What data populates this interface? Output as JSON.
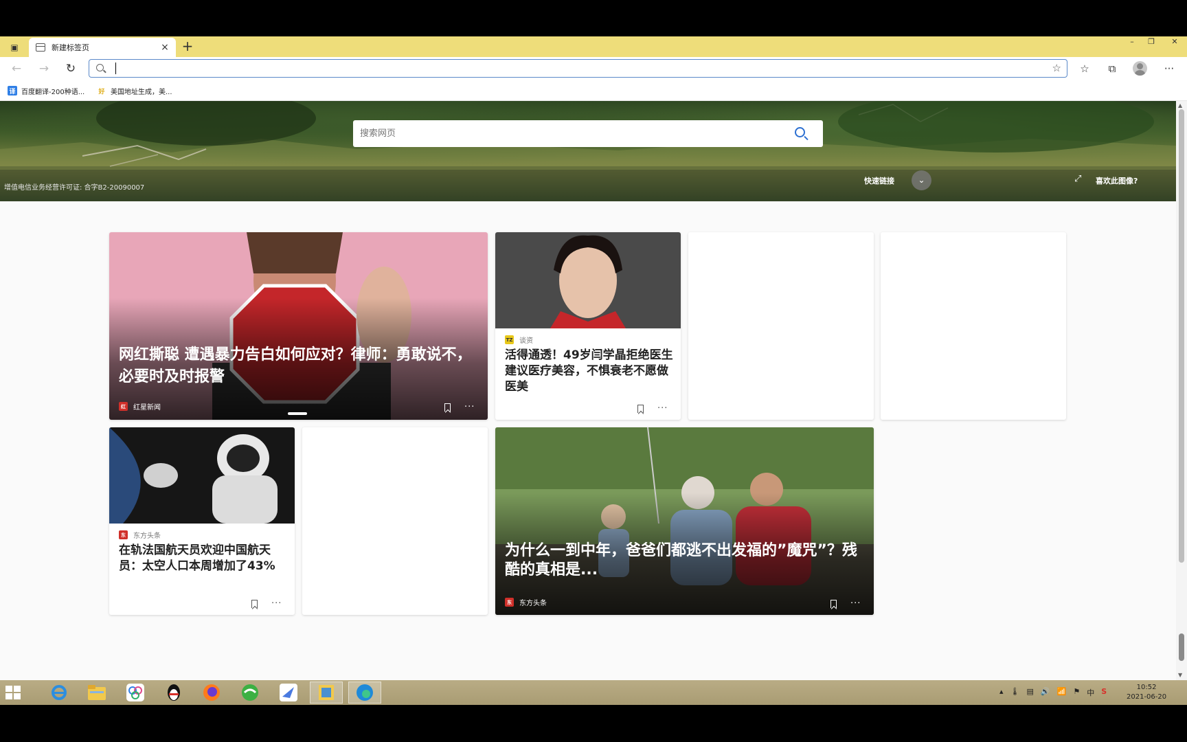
{
  "browser": {
    "tab_title": "新建标签页",
    "tab_close": "×",
    "new_tab": "+",
    "address_placeholder": "",
    "win_min": "–",
    "win_restore": "❐",
    "win_close": "✕"
  },
  "bookmarks": [
    {
      "label": "百度翻译-200种语...",
      "icon_text": "译",
      "icon_color": "#2f7fe6"
    },
    {
      "label": "美国地址生成，美...",
      "icon_text": "好",
      "icon_color": "#e0b020"
    }
  ],
  "hero": {
    "search_placeholder": "搜索网页",
    "license": "增值电信业务经营许可证: 合字B2-20090007",
    "quick_links": "快速链接",
    "like_image": "喜欢此图像?"
  },
  "cards": {
    "c1": {
      "title": "网红撕聪 遭遇暴力告白如何应对？律师：勇敢说不，必要时及时报警",
      "source": "红星新闻",
      "source_color": "#d0302a"
    },
    "c2": {
      "title": "活得通透！49岁闫学晶拒绝医生建议医疗美容，不惧衰老不愿做医美",
      "source": "谈资",
      "source_color": "#e8c81a"
    },
    "c5": {
      "title": "在轨法国航天员欢迎中国航天员：太空人口本周增加了43%",
      "source": "东方头条",
      "source_color": "#d0302a"
    },
    "c7": {
      "title": "为什么一到中年，爸爸们都逃不出发福的”魔咒”？残酷的真相是...",
      "source": "东方头条",
      "source_color": "#d0302a"
    }
  },
  "clock": {
    "time": "10:52",
    "date": "2021-06-20"
  },
  "tray": {
    "ime": "中"
  }
}
